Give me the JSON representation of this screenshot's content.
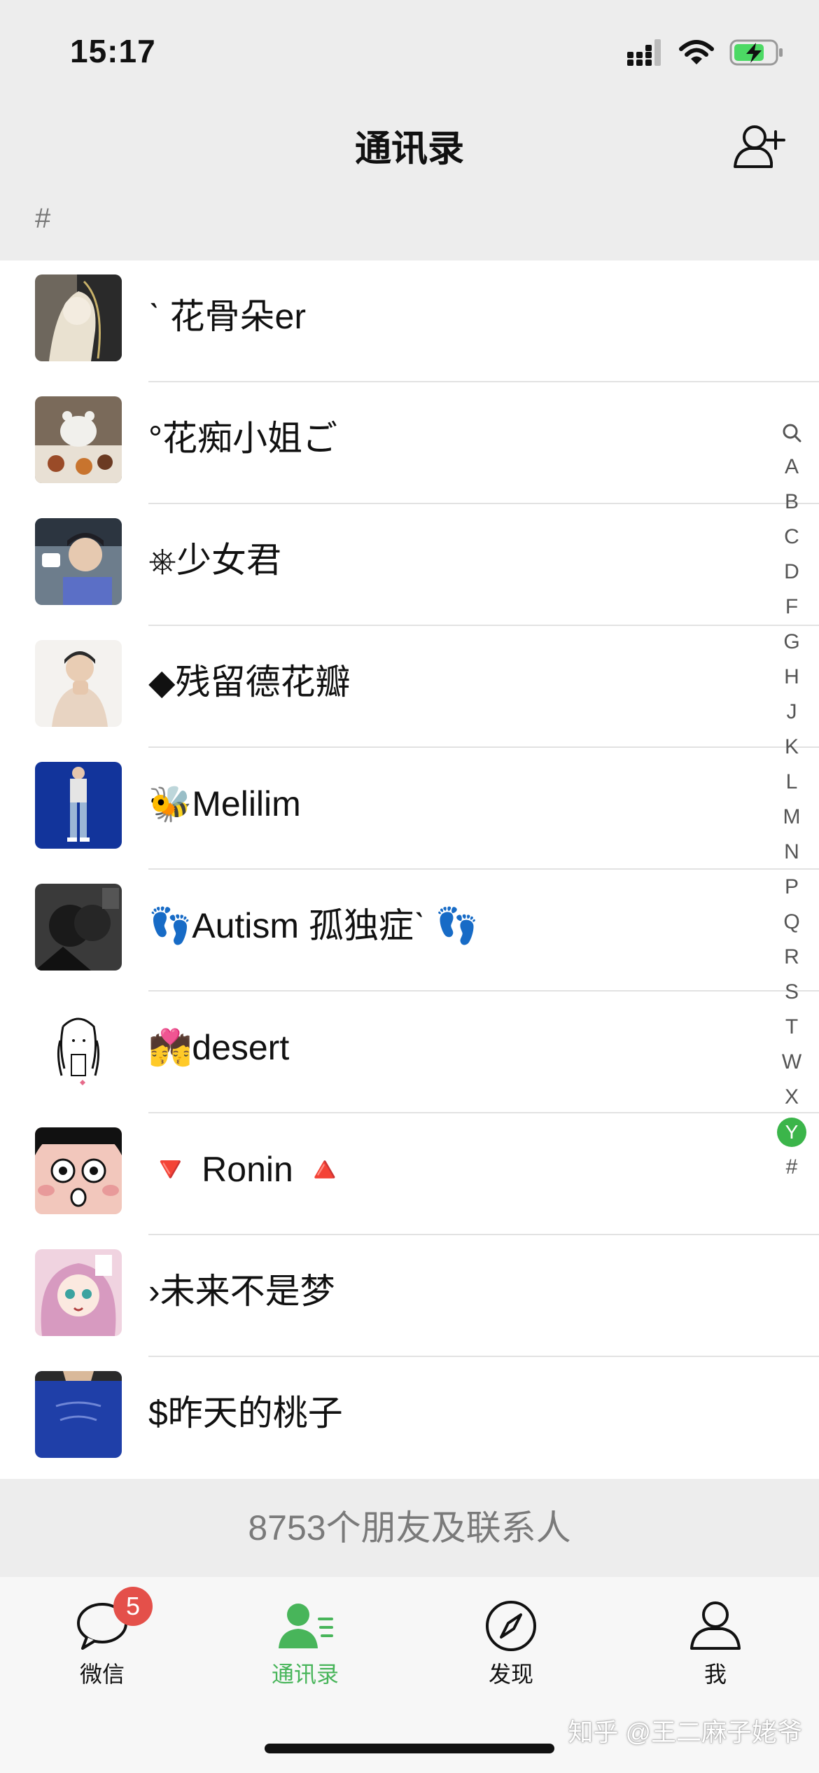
{
  "status_bar": {
    "time": "15:17"
  },
  "nav": {
    "title": "通讯录"
  },
  "section_header": "#",
  "contacts": [
    {
      "name": "ˋ 花骨朵er"
    },
    {
      "name": "°花痴小姐ご"
    },
    {
      "name": "⎈少女君"
    },
    {
      "name": "◆残留德花瓣"
    },
    {
      "name": "🐝Melilim"
    },
    {
      "name": "👣Autism 孤独症ˋ 👣"
    },
    {
      "name": "💏desert"
    },
    {
      "name": "🔻 Ronin 🔺"
    },
    {
      "name": "›未来不是梦"
    },
    {
      "name": "$昨天的桃子"
    }
  ],
  "footer_count": "8753个朋友及联系人",
  "index": [
    "🔍",
    "A",
    "B",
    "C",
    "D",
    "F",
    "G",
    "H",
    "J",
    "K",
    "L",
    "M",
    "N",
    "P",
    "Q",
    "R",
    "S",
    "T",
    "W",
    "X",
    "Y",
    "#"
  ],
  "index_active": "Y",
  "tabs": [
    {
      "label": "微信",
      "badge": "5",
      "icon": "chat-bubble-icon"
    },
    {
      "label": "通讯录",
      "icon": "contacts-icon",
      "active": true
    },
    {
      "label": "发现",
      "icon": "compass-icon"
    },
    {
      "label": "我",
      "icon": "person-icon"
    }
  ],
  "watermark": "知乎 @王二麻子姥爷",
  "colors": {
    "accent": "#48b55a",
    "badge": "#e4504a",
    "background": "#ededed"
  }
}
